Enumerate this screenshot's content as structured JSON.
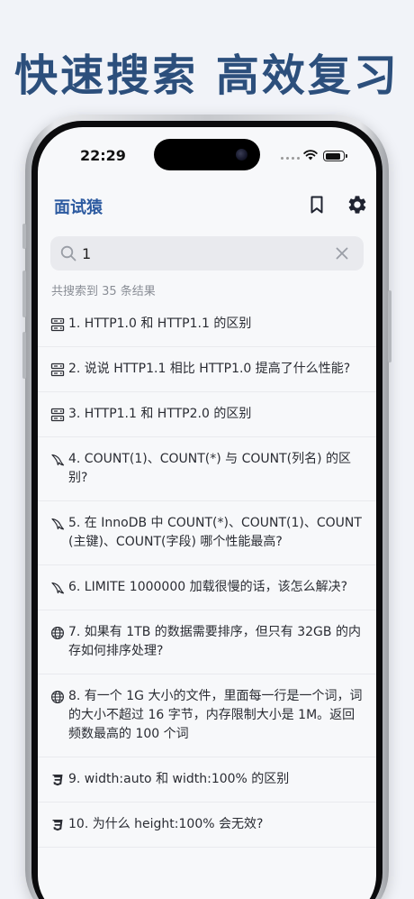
{
  "promo": {
    "headline": "快速搜索 高效复习"
  },
  "status_bar": {
    "time": "22:29"
  },
  "app_bar": {
    "title": "面试猿",
    "bookmark_icon": "bookmark-icon",
    "settings_icon": "gear-icon"
  },
  "search": {
    "value": "1",
    "placeholder": "",
    "result_count": "共搜索到 35 条结果"
  },
  "results": [
    {
      "icon": "server-icon",
      "text": "1. HTTP1.0 和 HTTP1.1 的区别"
    },
    {
      "icon": "server-icon",
      "text": "2. 说说 HTTP1.1 相比 HTTP1.0 提高了什么性能?"
    },
    {
      "icon": "server-icon",
      "text": "3. HTTP1.1 和 HTTP2.0 的区别"
    },
    {
      "icon": "dolphin-icon",
      "text": "4. COUNT(1)、COUNT(*) 与 COUNT(列名) 的区别?"
    },
    {
      "icon": "dolphin-icon",
      "text": "5. 在 InnoDB 中 COUNT(*)、COUNT(1)、COUNT(主键)、COUNT(字段) 哪个性能最高?"
    },
    {
      "icon": "dolphin-icon",
      "text": "6. LIMITE 1000000 加载很慢的话，该怎么解决?"
    },
    {
      "icon": "globe-icon",
      "text": "7. 如果有 1TB 的数据需要排序，但只有 32GB 的内存如何排序处理?"
    },
    {
      "icon": "globe-icon",
      "text": "8. 有一个 1G 大小的文件，里面每一行是一个词，词的大小不超过 16 字节，内存限制大小是 1M。返回频数最高的 100 个词"
    },
    {
      "icon": "css3-icon",
      "text": "9. width:auto 和 width:100% 的区别"
    },
    {
      "icon": "css3-icon",
      "text": "10. 为什么 height:100% 会无效?"
    }
  ],
  "colors": {
    "accent": "#2c5aa0",
    "headline": "#2c4f7c",
    "background": "#f1f3f8"
  }
}
